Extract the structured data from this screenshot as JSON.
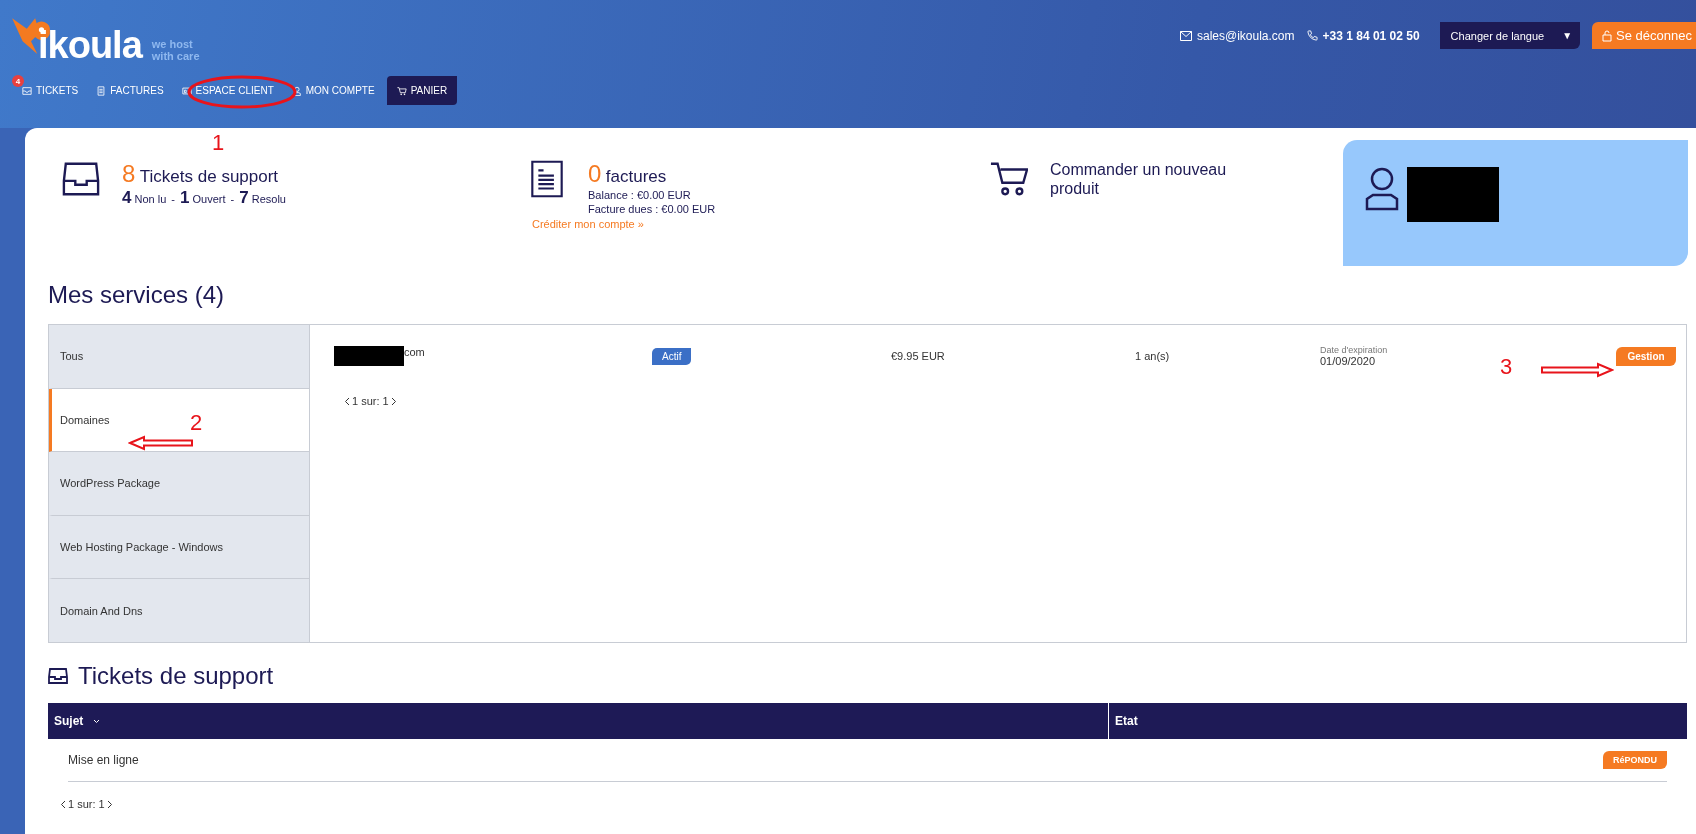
{
  "header": {
    "logo": {
      "name": "ikoula",
      "tagline_1": "we host",
      "tagline_2": "with care"
    },
    "contact": {
      "email": "sales@ikoula.com",
      "phone": "+33 1 84 01 02 50"
    },
    "language_button": "Changer de langue",
    "caret": "▼",
    "logout_button": "Se déconnec",
    "nav": [
      {
        "label": "TICKETS",
        "kind": "tickets",
        "badge": "4",
        "highlighted": false
      },
      {
        "label": "FACTURES",
        "kind": "invoice",
        "highlighted": false
      },
      {
        "label": "ESPACE CLIENT",
        "kind": "client",
        "highlighted": false
      },
      {
        "label": "MON COMPTE",
        "kind": "account",
        "highlighted": false
      },
      {
        "label": "PANIER",
        "kind": "cart",
        "highlighted": true
      }
    ]
  },
  "summary": {
    "tickets": {
      "count": "8",
      "label": "Tickets de support",
      "stats": [
        {
          "text": "**4** Non lu",
          "separator": "-"
        },
        {
          "text": "**1** Ouvert",
          "separator": "-"
        },
        {
          "text": "**7** Resolu"
        }
      ]
    },
    "invoices": {
      "count": "0",
      "label": "factures",
      "balance": "Balance : €0.00 EUR",
      "due": "Facture dues : €0.00 EUR",
      "link": "Créditer mon compte »"
    },
    "order": {
      "label": "Commander un nouveau produit"
    }
  },
  "services": {
    "title": "Mes services (4)",
    "categories": [
      {
        "label": "Tous",
        "selected": false
      },
      {
        "label": "Domaines",
        "selected": true
      },
      {
        "label": "WordPress Package",
        "selected": false
      },
      {
        "label": "Web Hosting Package - Windows",
        "selected": false
      },
      {
        "label": "Domain And Dns",
        "selected": false
      }
    ],
    "rows": [
      {
        "domain_visible": "com",
        "status": "Actif",
        "price": "€9.95 EUR",
        "period": "1 an(s)",
        "expiry_label": "Date d'expiration",
        "expiry": "01/09/2020",
        "action": "Gestion"
      }
    ],
    "pagination": "1 sur: 1"
  },
  "tickets": {
    "title": "Tickets de support",
    "columns": [
      "Sujet",
      "Etat"
    ],
    "rows": [
      {
        "subject": "Mise en ligne",
        "status": "RéPONDU"
      }
    ],
    "pagination": "1 sur: 1"
  },
  "annotations": [
    {
      "kind": "ellipse",
      "label": "1"
    },
    {
      "kind": "arrow_left",
      "label": "2"
    },
    {
      "kind": "arrow_right",
      "label": "3"
    }
  ]
}
